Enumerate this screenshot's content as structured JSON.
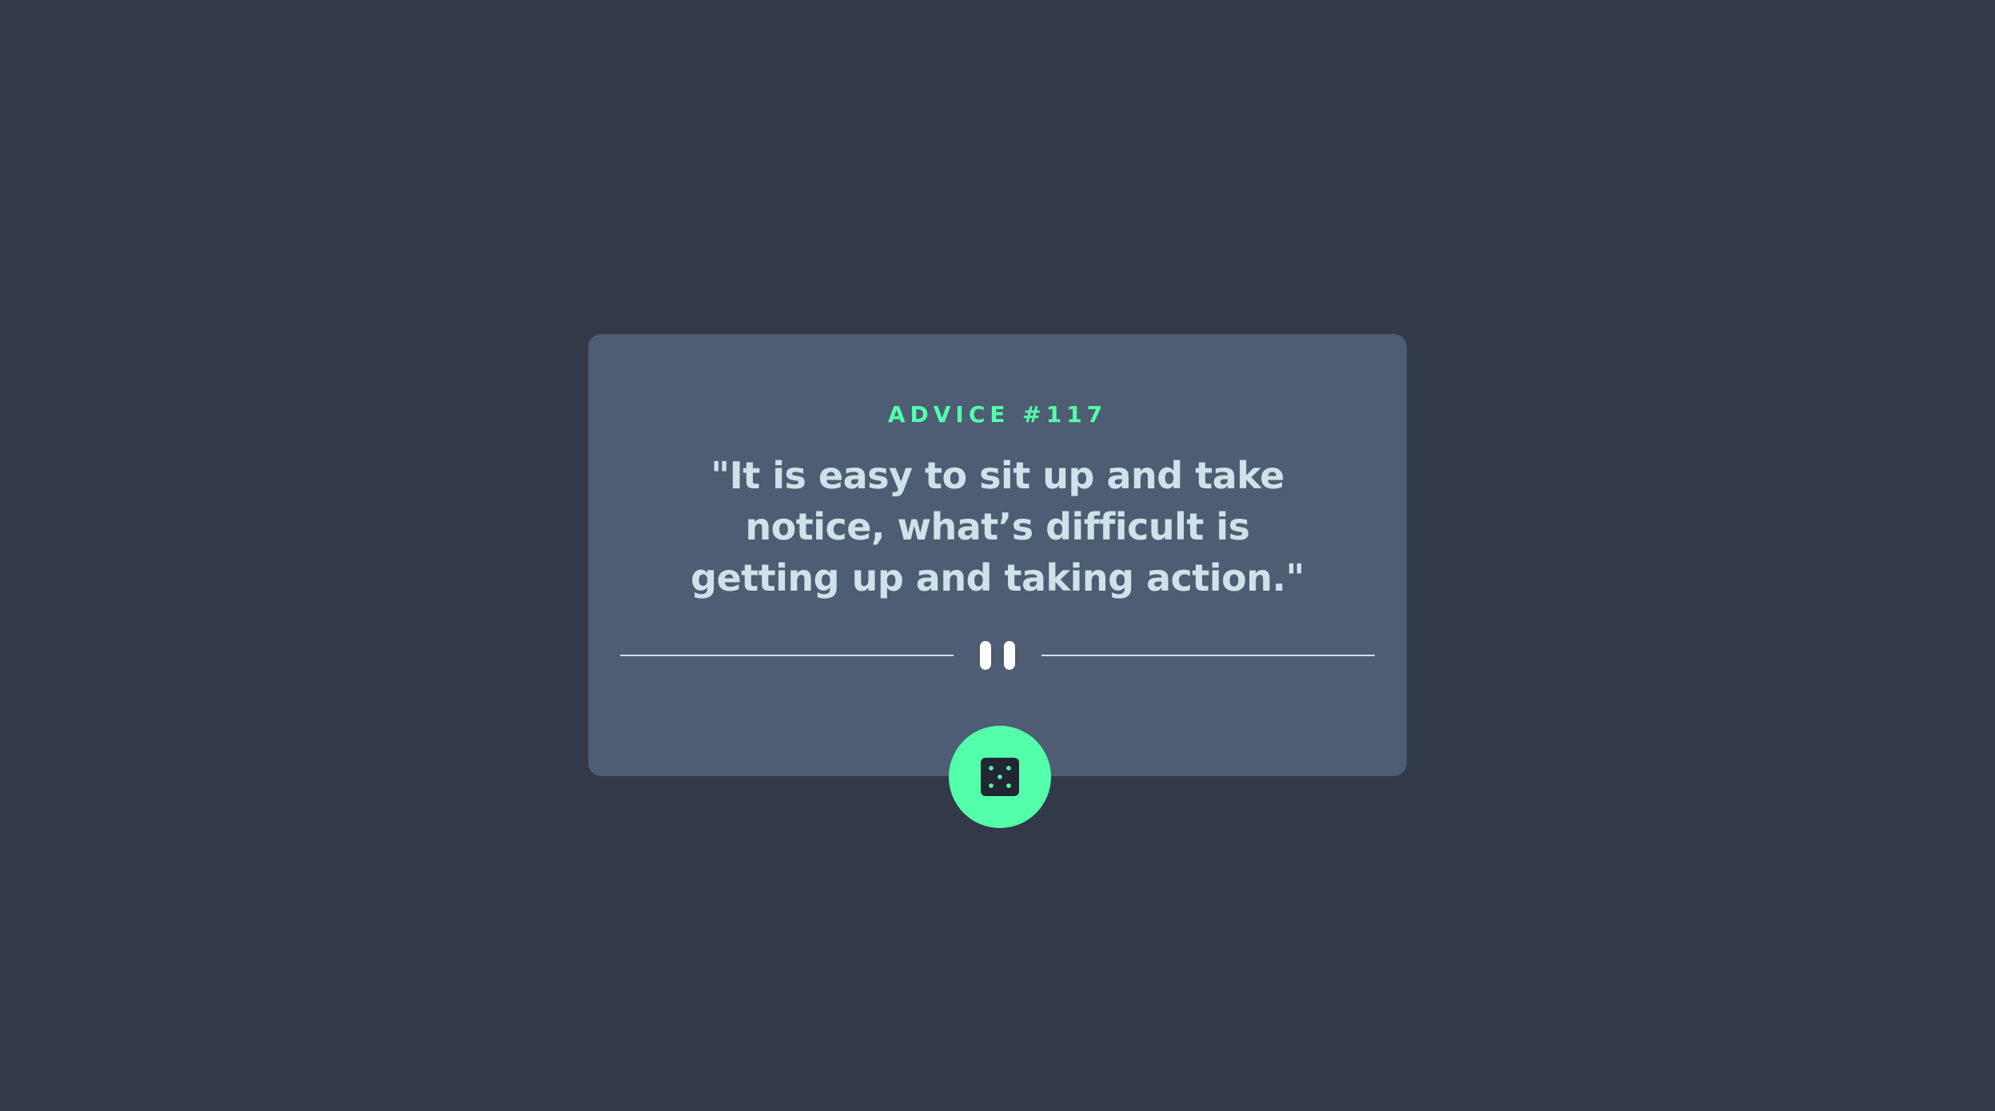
{
  "advice": {
    "id_label": "ADVICE #117",
    "text": "\"It is easy to sit up and take notice, what’s difficult is getting up and taking action.\""
  },
  "icons": {
    "divider": "pause-icon",
    "button": "dice-icon"
  },
  "colors": {
    "background": "#323a49",
    "card": "#4e5d73",
    "accent": "#53ffaa",
    "text": "#cee3e9",
    "dark": "#202733"
  }
}
